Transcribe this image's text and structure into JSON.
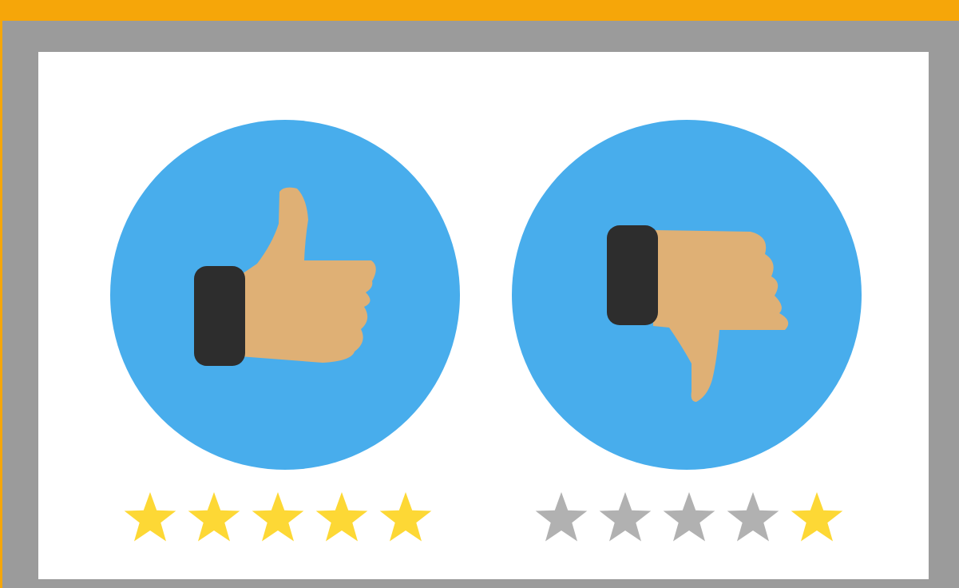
{
  "colors": {
    "accent_bar": "#f6a609",
    "frame": "#9b9b9b",
    "panel": "#ffffff",
    "circle": "#48adec",
    "skin": "#dfb075",
    "cuff": "#2d2d2d",
    "star_filled": "#fdd835",
    "star_empty": "#b1b1b1"
  },
  "ratings": [
    {
      "icon": "thumbs-up-icon",
      "stars_filled": [
        true,
        true,
        true,
        true,
        true
      ]
    },
    {
      "icon": "thumbs-down-icon",
      "stars_filled": [
        false,
        false,
        false,
        false,
        true
      ]
    }
  ]
}
